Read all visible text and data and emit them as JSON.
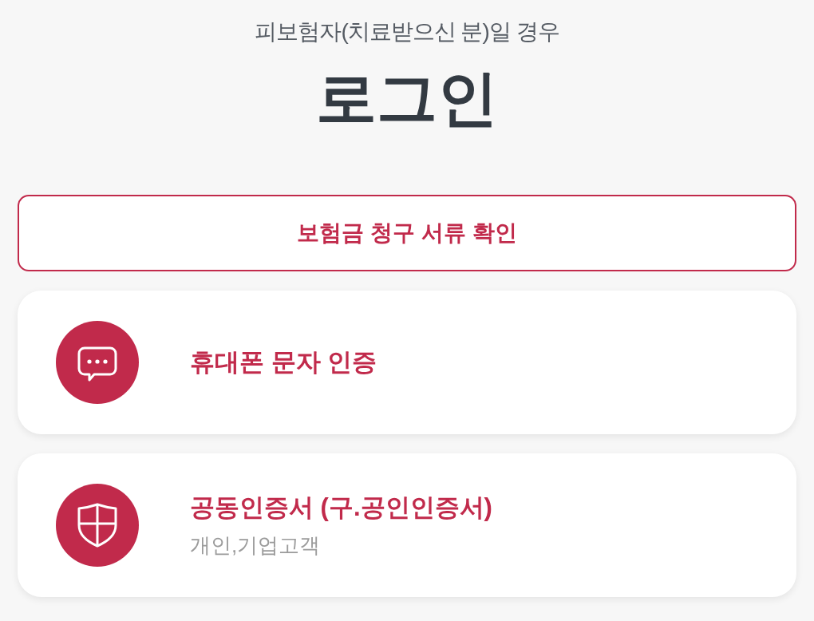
{
  "header": {
    "subtitle": "피보험자(치료받으신 분)일 경우",
    "title": "로그인"
  },
  "claim_button": {
    "label": "보험금 청구 서류 확인"
  },
  "login_options": [
    {
      "kind": "sms",
      "title": "휴대폰 문자 인증"
    },
    {
      "kind": "certificate",
      "title": "공동인증서 (구.공인인증서)",
      "subtitle": "개인,기업고객"
    }
  ]
}
